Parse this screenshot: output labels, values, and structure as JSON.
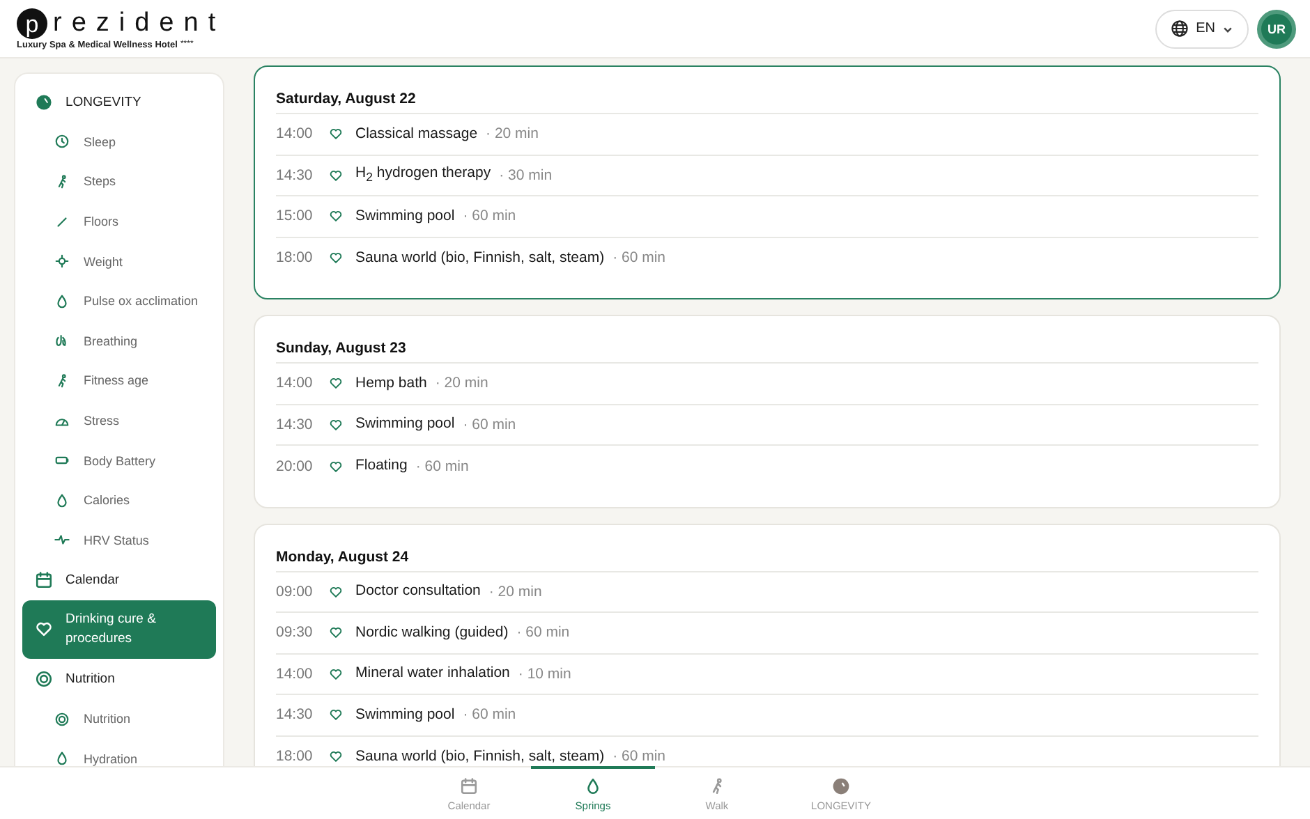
{
  "header": {
    "logo_mark": "p",
    "logo_text": "rezident",
    "tagline": "Luxury Spa & Medical Wellness Hotel",
    "stars": "****",
    "language": "EN",
    "avatar": "UR"
  },
  "sidebar": {
    "items": [
      {
        "label": "LONGEVITY",
        "kind": "section",
        "selected": false
      },
      {
        "label": "Sleep",
        "kind": "sub",
        "selected": false
      },
      {
        "label": "Steps",
        "kind": "sub",
        "selected": false
      },
      {
        "label": "Floors",
        "kind": "sub",
        "selected": false
      },
      {
        "label": "Weight",
        "kind": "sub",
        "selected": false
      },
      {
        "label": "Pulse ox acclimation",
        "kind": "sub",
        "selected": false
      },
      {
        "label": "Breathing",
        "kind": "sub",
        "selected": false
      },
      {
        "label": "Fitness age",
        "kind": "sub",
        "selected": false
      },
      {
        "label": "Stress",
        "kind": "sub",
        "selected": false
      },
      {
        "label": "Body Battery",
        "kind": "sub",
        "selected": false
      },
      {
        "label": "Calories",
        "kind": "sub",
        "selected": false
      },
      {
        "label": "HRV Status",
        "kind": "sub",
        "selected": false
      },
      {
        "label": "Calendar",
        "kind": "section",
        "selected": false
      },
      {
        "label": "Drinking cure & procedures",
        "kind": "section",
        "selected": true
      },
      {
        "label": "Nutrition",
        "kind": "section",
        "selected": false
      },
      {
        "label": "Nutrition",
        "kind": "sub",
        "selected": false
      },
      {
        "label": "Hydration",
        "kind": "sub",
        "selected": false
      }
    ]
  },
  "days": [
    {
      "title": "Saturday, August 22",
      "selected": true,
      "entries": [
        {
          "time": "14:00",
          "name": "Classical massage",
          "duration": "· 20 min"
        },
        {
          "time": "14:30",
          "name": "H$_{2}$ hydrogen therapy",
          "duration": "· 30 min"
        },
        {
          "time": "15:00",
          "name": "Swimming pool",
          "duration": "· 60 min"
        },
        {
          "time": "18:00",
          "name": "Sauna world (bio, Finnish, salt, steam)",
          "duration": "· 60 min"
        }
      ]
    },
    {
      "title": "Sunday, August 23",
      "selected": false,
      "entries": [
        {
          "time": "14:00",
          "name": "Hemp bath",
          "duration": "· 20 min"
        },
        {
          "time": "14:30",
          "name": "Swimming pool",
          "duration": "· 60 min"
        },
        {
          "time": "20:00",
          "name": "Floating",
          "duration": "· 60 min"
        }
      ]
    },
    {
      "title": "Monday, August 24",
      "selected": false,
      "entries": [
        {
          "time": "09:00",
          "name": "Doctor consultation",
          "duration": "· 20 min"
        },
        {
          "time": "09:30",
          "name": "Nordic walking (guided)",
          "duration": "· 60 min"
        },
        {
          "time": "14:00",
          "name": "Mineral water inhalation",
          "duration": "· 10 min"
        },
        {
          "time": "14:30",
          "name": "Swimming pool",
          "duration": "· 60 min"
        },
        {
          "time": "18:00",
          "name": "Sauna world (bio, Finnish, salt, steam)",
          "duration": "· 60 min"
        }
      ]
    }
  ],
  "bottom_nav": [
    {
      "label": "Calendar",
      "selected": false
    },
    {
      "label": "Springs",
      "selected": true
    },
    {
      "label": "Walk",
      "selected": false
    },
    {
      "label": "LONGEVITY",
      "selected": false
    }
  ]
}
